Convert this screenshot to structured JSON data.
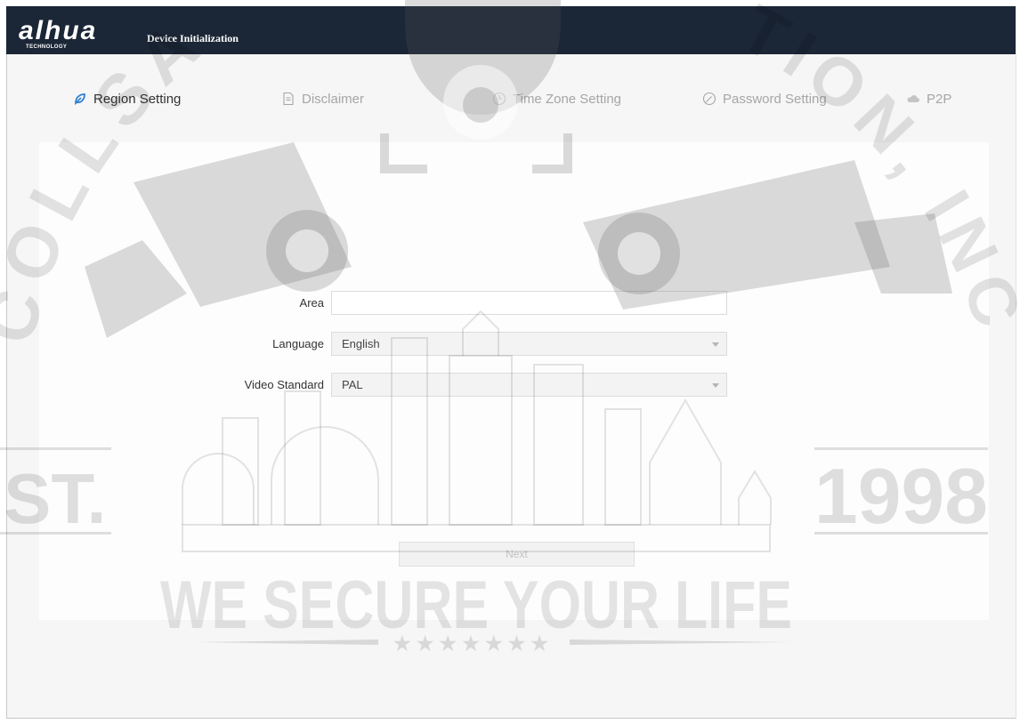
{
  "app": {
    "logo": "alhua",
    "logo_sub": "TECHNOLOGY",
    "title": "Device Initialization"
  },
  "steps": [
    {
      "label": "Region Setting",
      "icon": "location-icon",
      "active": true
    },
    {
      "label": "Disclaimer",
      "icon": "document-icon",
      "active": false
    },
    {
      "label": "Time Zone Setting",
      "icon": "clock-icon",
      "active": false
    },
    {
      "label": "Password Setting",
      "icon": "password-icon",
      "active": false
    },
    {
      "label": "P2P",
      "icon": "cloud-icon",
      "active": false
    }
  ],
  "form": {
    "area": {
      "label": "Area",
      "value": ""
    },
    "language": {
      "label": "Language",
      "value": "English"
    },
    "video_standard": {
      "label": "Video Standard",
      "value": "PAL"
    }
  },
  "actions": {
    "next_label": "Next"
  },
  "colors": {
    "header_bg": "#1b2636",
    "active_step_icon": "#2f7fd3",
    "inactive_step": "#a6a6a6"
  },
  "watermark": {
    "arc_left": "COLLSA",
    "arc_right": "TION, INC",
    "left_mark": "ST.",
    "year": "1998",
    "slogan": "WE SECURE YOUR LIFE",
    "stars": "★★★★★★★"
  }
}
